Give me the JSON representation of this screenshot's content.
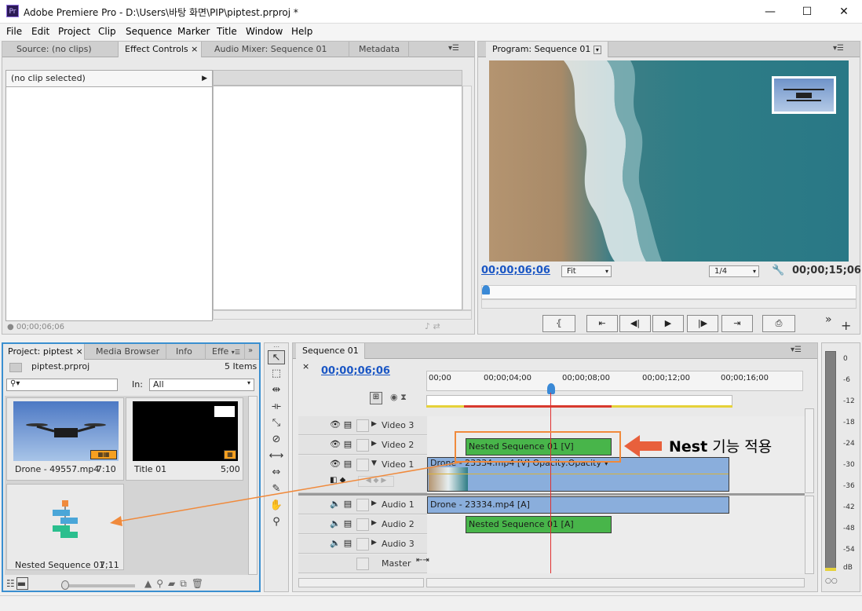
{
  "window": {
    "app_icon": "Pr",
    "title": "Adobe Premiere Pro - D:\\Users\\바탕 화면\\PIP\\piptest.prproj *",
    "minimize": "—",
    "maximize": "☐",
    "close": "✕"
  },
  "menu": [
    "File",
    "Edit",
    "Project",
    "Clip",
    "Sequence",
    "Marker",
    "Title",
    "Window",
    "Help"
  ],
  "source_panel": {
    "tabs": [
      "Source: (no clips)",
      "Effect Controls",
      "Audio Mixer: Sequence 01",
      "Metadata"
    ],
    "active_tab_close": "×",
    "clip_selector": "(no clip selected)",
    "timecode": "00;00;06;06"
  },
  "program_panel": {
    "tab": "Program: Sequence 01",
    "current_time": "00;00;06;06",
    "zoom": "Fit",
    "resolution": "1/4",
    "duration": "00;00;15;06",
    "pip_present": true
  },
  "project_panel": {
    "tabs": [
      "Project: piptest",
      "Media Browser",
      "Info",
      "Effe"
    ],
    "project_file": "piptest.prproj",
    "item_count": "5 Items",
    "in_label": "In:",
    "in_value": "All",
    "items": [
      {
        "name": "Drone - 49557.mp4",
        "duration": "7:10"
      },
      {
        "name": "Title 01",
        "duration": "5;00"
      },
      {
        "name": "Nested Sequence 01",
        "duration": "7;11"
      }
    ]
  },
  "timeline": {
    "tab": "Sequence 01",
    "current_time": "00;00;06;06",
    "ruler": [
      "00;00",
      "00;00;04;00",
      "00;00;08;00",
      "00;00;12;00",
      "00;00;16;00"
    ],
    "tracks": [
      {
        "name": "Video 3"
      },
      {
        "name": "Video 2"
      },
      {
        "name": "Video 1"
      },
      {
        "name": "Audio 1"
      },
      {
        "name": "Audio 2"
      },
      {
        "name": "Audio 3"
      },
      {
        "name": "Master"
      }
    ],
    "clips": {
      "nested_v": "Nested Sequence 01 [V]",
      "drone_v": "Drone - 23334.mp4 [V]  Opacity:Opacity ▾",
      "drone_a": "Drone - 23334.mp4 [A]",
      "nested_a": "Nested Sequence 01 [A]"
    }
  },
  "annotation": {
    "label_bold": "Nest",
    "label_rest": " 기능 적용",
    "arrow_color": "#e8603c",
    "highlight_color": "#f08a3c"
  },
  "audio_meter": {
    "scale": [
      "0",
      "-6",
      "-12",
      "-18",
      "-24",
      "-30",
      "-36",
      "-42",
      "-48",
      "-54",
      "dB"
    ]
  },
  "colors": {
    "accent_blue": "#1a56c4",
    "clip_green": "#48b54a",
    "clip_blue": "#8aaedc",
    "playhead_red": "#e03030"
  }
}
